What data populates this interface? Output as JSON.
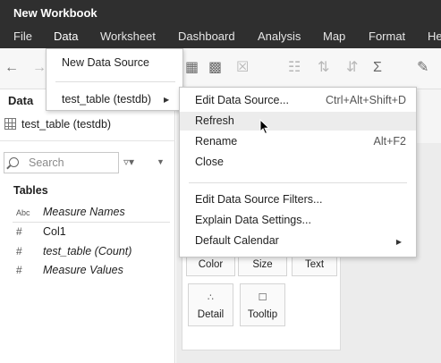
{
  "window": {
    "title": "New Workbook"
  },
  "menubar": {
    "items": [
      "File",
      "Data",
      "Worksheet",
      "Dashboard",
      "Analysis",
      "Map",
      "Format",
      "He"
    ]
  },
  "toolbar": {
    "icons": [
      "back-arrow",
      "forward-arrow",
      "new-worksheet",
      "duplicate-chart",
      "clear-sheet",
      "group",
      "sort-ascending",
      "sort-descending",
      "totals",
      "highlight"
    ]
  },
  "data_pane": {
    "title": "Data",
    "data_source": "test_table (testdb)",
    "search_placeholder": "Search",
    "tables_header": "Tables",
    "fields": [
      {
        "type": "Abc",
        "name": "Measure Names",
        "italic": true
      },
      {
        "type": "#",
        "name": "Col1",
        "italic": false
      },
      {
        "type": "#",
        "name": "test_table (Count)",
        "italic": true
      },
      {
        "type": "#",
        "name": "Measure Values",
        "italic": true
      }
    ]
  },
  "data_menu": {
    "items": [
      "New Data Source",
      "test_table (testdb)"
    ]
  },
  "submenu": {
    "items": [
      {
        "label": "Edit Data Source...",
        "shortcut": "Ctrl+Alt+Shift+D"
      },
      {
        "label": "Refresh",
        "shortcut": ""
      },
      {
        "label": "Rename",
        "shortcut": "Alt+F2"
      },
      {
        "label": "Close",
        "shortcut": ""
      },
      {
        "label": "Edit Data Source Filters...",
        "shortcut": ""
      },
      {
        "label": "Explain Data Settings...",
        "shortcut": ""
      },
      {
        "label": "Default Calendar",
        "shortcut": ""
      }
    ],
    "hovered": "Refresh"
  },
  "marks_card": {
    "buttons": [
      "Color",
      "Size",
      "Text",
      "Detail",
      "Tooltip"
    ]
  },
  "colors": {
    "menubar_bg": "#2f2f2f",
    "hover_bg": "#ececec"
  }
}
